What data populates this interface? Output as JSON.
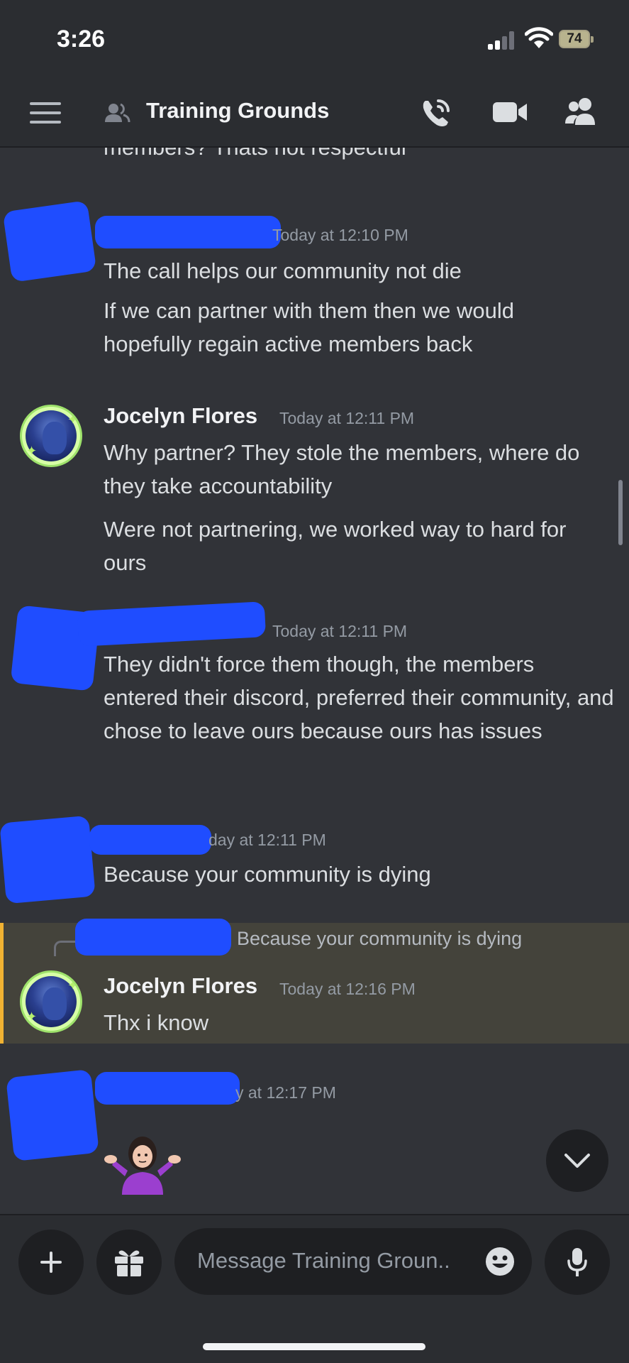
{
  "status_bar": {
    "time": "3:26",
    "battery": "74"
  },
  "header": {
    "title": "Training Grounds"
  },
  "messages": {
    "m0": {
      "lines": [
        "members? Thats not respectful"
      ]
    },
    "m1": {
      "timestamp": "Today at 12:10 PM",
      "line1": "The call helps our community not die",
      "line2": "If we can partner with them then we would hopefully regain active members back"
    },
    "m2": {
      "author": "Jocelyn Flores",
      "timestamp": "Today at 12:11 PM",
      "line1": "Why partner? They stole the members, where do they take accountability",
      "line2": "Were not partnering, we worked way to hard for ours"
    },
    "m3": {
      "timestamp": "Today at 12:11 PM",
      "line1": "They didn't force them though, the members entered their discord, preferred their community, and chose to leave ours because ours has issues"
    },
    "m4": {
      "timestamp": "day at 12:11 PM",
      "line1": "Because your community is dying"
    },
    "m5": {
      "reply_preview": "Because your community is dying",
      "author": "Jocelyn Flores",
      "timestamp": "Today at 12:16 PM",
      "line1": "Thx i know"
    },
    "m6": {
      "timestamp": "y at 12:17 PM",
      "emoji_name": "person-shrugging-emoji"
    }
  },
  "composer": {
    "placeholder": "Message Training Groun.."
  },
  "colors": {
    "background": "#313338",
    "header": "#2b2d31",
    "accent_mention": "#f0b232",
    "scribble": "#1f4dff"
  }
}
